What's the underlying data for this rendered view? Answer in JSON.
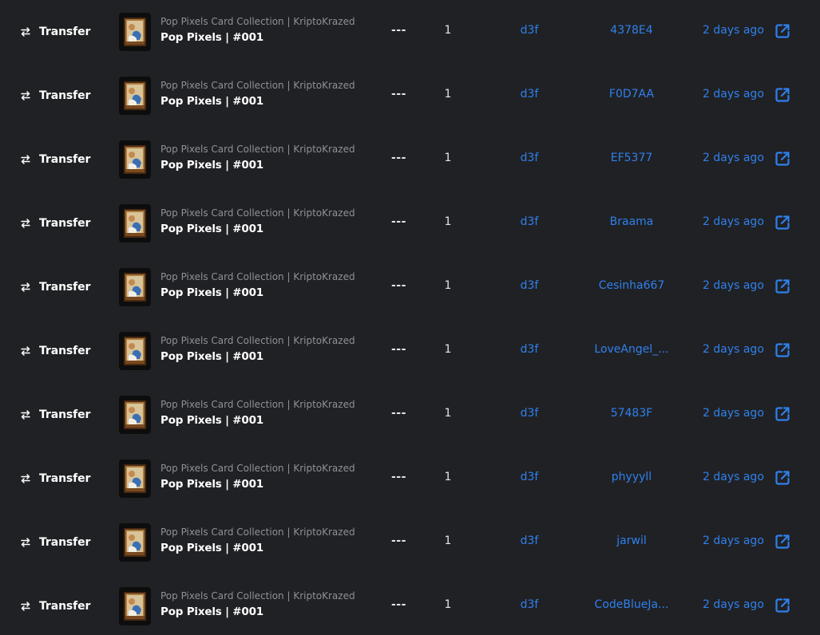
{
  "colors": {
    "background": "#202124",
    "link": "#2f80ed",
    "primary_text": "#ffffff",
    "secondary_text": "#8e9196"
  },
  "rows": [
    {
      "event": "Transfer",
      "event_icon": "transfer-arrows-icon",
      "collection": "Pop Pixels Card Collection | KriptoKrazed",
      "item": "Pop Pixels | #001",
      "price": "---",
      "quantity": "1",
      "from": "d3f",
      "to": "4378E4",
      "time": "2 days ago",
      "link_icon": "external-link-icon"
    },
    {
      "event": "Transfer",
      "event_icon": "transfer-arrows-icon",
      "collection": "Pop Pixels Card Collection | KriptoKrazed",
      "item": "Pop Pixels | #001",
      "price": "---",
      "quantity": "1",
      "from": "d3f",
      "to": "F0D7AA",
      "time": "2 days ago",
      "link_icon": "external-link-icon"
    },
    {
      "event": "Transfer",
      "event_icon": "transfer-arrows-icon",
      "collection": "Pop Pixels Card Collection | KriptoKrazed",
      "item": "Pop Pixels | #001",
      "price": "---",
      "quantity": "1",
      "from": "d3f",
      "to": "EF5377",
      "time": "2 days ago",
      "link_icon": "external-link-icon"
    },
    {
      "event": "Transfer",
      "event_icon": "transfer-arrows-icon",
      "collection": "Pop Pixels Card Collection | KriptoKrazed",
      "item": "Pop Pixels | #001",
      "price": "---",
      "quantity": "1",
      "from": "d3f",
      "to": "Braama",
      "time": "2 days ago",
      "link_icon": "external-link-icon"
    },
    {
      "event": "Transfer",
      "event_icon": "transfer-arrows-icon",
      "collection": "Pop Pixels Card Collection | KriptoKrazed",
      "item": "Pop Pixels | #001",
      "price": "---",
      "quantity": "1",
      "from": "d3f",
      "to": "Cesinha667",
      "time": "2 days ago",
      "link_icon": "external-link-icon"
    },
    {
      "event": "Transfer",
      "event_icon": "transfer-arrows-icon",
      "collection": "Pop Pixels Card Collection | KriptoKrazed",
      "item": "Pop Pixels | #001",
      "price": "---",
      "quantity": "1",
      "from": "d3f",
      "to": "LoveAngel_...",
      "time": "2 days ago",
      "link_icon": "external-link-icon"
    },
    {
      "event": "Transfer",
      "event_icon": "transfer-arrows-icon",
      "collection": "Pop Pixels Card Collection | KriptoKrazed",
      "item": "Pop Pixels | #001",
      "price": "---",
      "quantity": "1",
      "from": "d3f",
      "to": "57483F",
      "time": "2 days ago",
      "link_icon": "external-link-icon"
    },
    {
      "event": "Transfer",
      "event_icon": "transfer-arrows-icon",
      "collection": "Pop Pixels Card Collection | KriptoKrazed",
      "item": "Pop Pixels | #001",
      "price": "---",
      "quantity": "1",
      "from": "d3f",
      "to": "phyyyll",
      "time": "2 days ago",
      "link_icon": "external-link-icon"
    },
    {
      "event": "Transfer",
      "event_icon": "transfer-arrows-icon",
      "collection": "Pop Pixels Card Collection | KriptoKrazed",
      "item": "Pop Pixels | #001",
      "price": "---",
      "quantity": "1",
      "from": "d3f",
      "to": "jarwil",
      "time": "2 days ago",
      "link_icon": "external-link-icon"
    },
    {
      "event": "Transfer",
      "event_icon": "transfer-arrows-icon",
      "collection": "Pop Pixels Card Collection | KriptoKrazed",
      "item": "Pop Pixels | #001",
      "price": "---",
      "quantity": "1",
      "from": "d3f",
      "to": "CodeBlueJa...",
      "time": "2 days ago",
      "link_icon": "external-link-icon"
    }
  ]
}
